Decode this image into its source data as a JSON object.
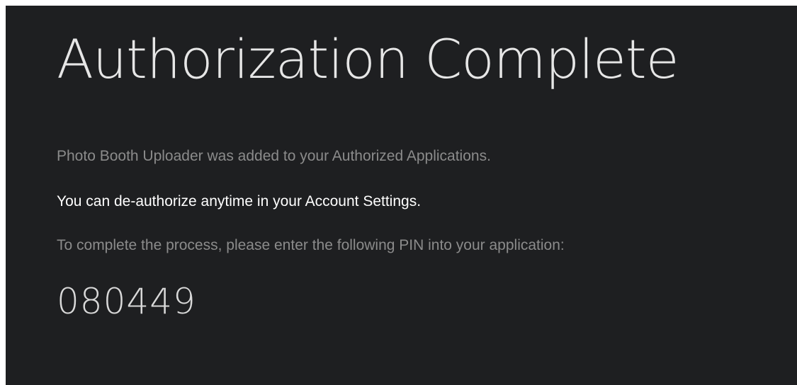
{
  "page": {
    "title": "Authorization Complete",
    "added_message": "Photo Booth Uploader was added to your Authorized Applications.",
    "deauthorize_message": "You can de-authorize anytime in your Account Settings.",
    "instruction": "To complete the process, please enter the following PIN into your application:",
    "pin": "080449"
  },
  "colors": {
    "background": "#1e1f21",
    "title": "#e6e6e6",
    "muted_text": "#8b8b8b",
    "emphasis_text": "#ffffff"
  }
}
